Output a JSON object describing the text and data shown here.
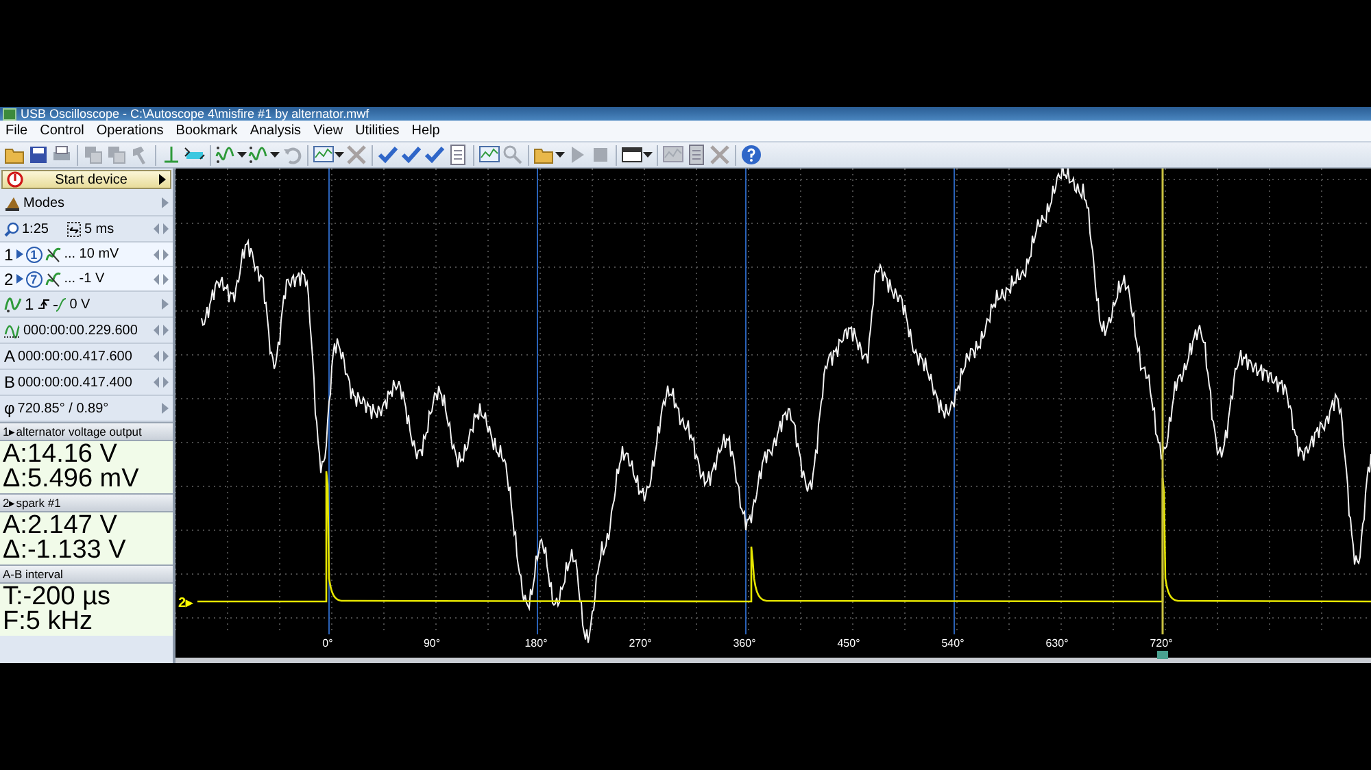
{
  "window": {
    "title": "USB Oscilloscope - C:\\Autoscope 4\\misfire #1 by alternator.mwf"
  },
  "menu": [
    "File",
    "Control",
    "Operations",
    "Bookmark",
    "Analysis",
    "View",
    "Utilities",
    "Help"
  ],
  "toolbar": [
    {
      "kind": "open",
      "disabled": false,
      "dropdown": false
    },
    {
      "kind": "save",
      "disabled": false,
      "dropdown": false
    },
    {
      "kind": "print",
      "disabled": false,
      "dropdown": false
    },
    {
      "kind": "sep"
    },
    {
      "kind": "copy",
      "disabled": true,
      "dropdown": false
    },
    {
      "kind": "copy",
      "disabled": true,
      "dropdown": false
    },
    {
      "kind": "tool",
      "disabled": true,
      "dropdown": false
    },
    {
      "kind": "sep"
    },
    {
      "kind": "cursor",
      "disabled": false,
      "dropdown": false
    },
    {
      "kind": "marker",
      "disabled": false,
      "dropdown": false
    },
    {
      "kind": "sep"
    },
    {
      "kind": "wave",
      "disabled": false,
      "dropdown": true
    },
    {
      "kind": "wave",
      "disabled": false,
      "dropdown": true
    },
    {
      "kind": "undo",
      "disabled": true,
      "dropdown": false
    },
    {
      "kind": "sep"
    },
    {
      "kind": "chart",
      "disabled": false,
      "dropdown": true
    },
    {
      "kind": "cross",
      "disabled": true,
      "dropdown": false
    },
    {
      "kind": "sep"
    },
    {
      "kind": "check",
      "disabled": false,
      "dropdown": false
    },
    {
      "kind": "check",
      "disabled": false,
      "dropdown": false
    },
    {
      "kind": "check",
      "disabled": false,
      "dropdown": false
    },
    {
      "kind": "doc",
      "disabled": false,
      "dropdown": false
    },
    {
      "kind": "sep"
    },
    {
      "kind": "chart",
      "disabled": false,
      "dropdown": false
    },
    {
      "kind": "zoom",
      "disabled": true,
      "dropdown": false
    },
    {
      "kind": "sep"
    },
    {
      "kind": "open",
      "disabled": false,
      "dropdown": true
    },
    {
      "kind": "play",
      "disabled": true,
      "dropdown": false
    },
    {
      "kind": "stop",
      "disabled": true,
      "dropdown": false
    },
    {
      "kind": "sep"
    },
    {
      "kind": "panel",
      "disabled": false,
      "dropdown": true
    },
    {
      "kind": "sep"
    },
    {
      "kind": "chart",
      "disabled": true,
      "dropdown": false
    },
    {
      "kind": "doc",
      "disabled": true,
      "dropdown": false
    },
    {
      "kind": "cross",
      "disabled": true,
      "dropdown": false
    },
    {
      "kind": "sep"
    },
    {
      "kind": "help",
      "disabled": false,
      "dropdown": false
    }
  ],
  "sidebar": {
    "start": {
      "label": "Start device"
    },
    "modes": {
      "label": "Modes"
    },
    "scale": {
      "zoom": "1:25",
      "timebase": "5 ms"
    },
    "channels": [
      {
        "number": "1",
        "probe": "1",
        "value": "... 10 mV",
        "selected": true
      },
      {
        "number": "2",
        "probe": "7",
        "value": "... -1 V",
        "selected": true
      }
    ],
    "trigger": {
      "channel": "1",
      "level": "0 V"
    },
    "position": "000:00:00.229.600",
    "cursor_a": {
      "label": "A",
      "value": "000:00:00.417.600"
    },
    "cursor_b": {
      "label": "B",
      "value": "000:00:00.417.400"
    },
    "phase": {
      "label": "φ",
      "value": "720.85° / 0.89°"
    },
    "readouts": [
      {
        "header": "1▸alternator voltage output",
        "lines": [
          "A:14.16 V",
          "Δ:5.496 mV"
        ]
      },
      {
        "header": "2▸spark #1",
        "lines": [
          "A:2.147 V",
          "Δ:-1.133 V"
        ]
      },
      {
        "header": "A-B interval",
        "lines": [
          "T:-200 µs",
          "F:5 kHz"
        ]
      }
    ]
  },
  "plot": {
    "channel_label": "2▸",
    "x_labels": [
      "0°",
      "90°",
      "180°",
      "270°",
      "360°",
      "450°",
      "540°",
      "630°",
      "720°"
    ]
  }
}
